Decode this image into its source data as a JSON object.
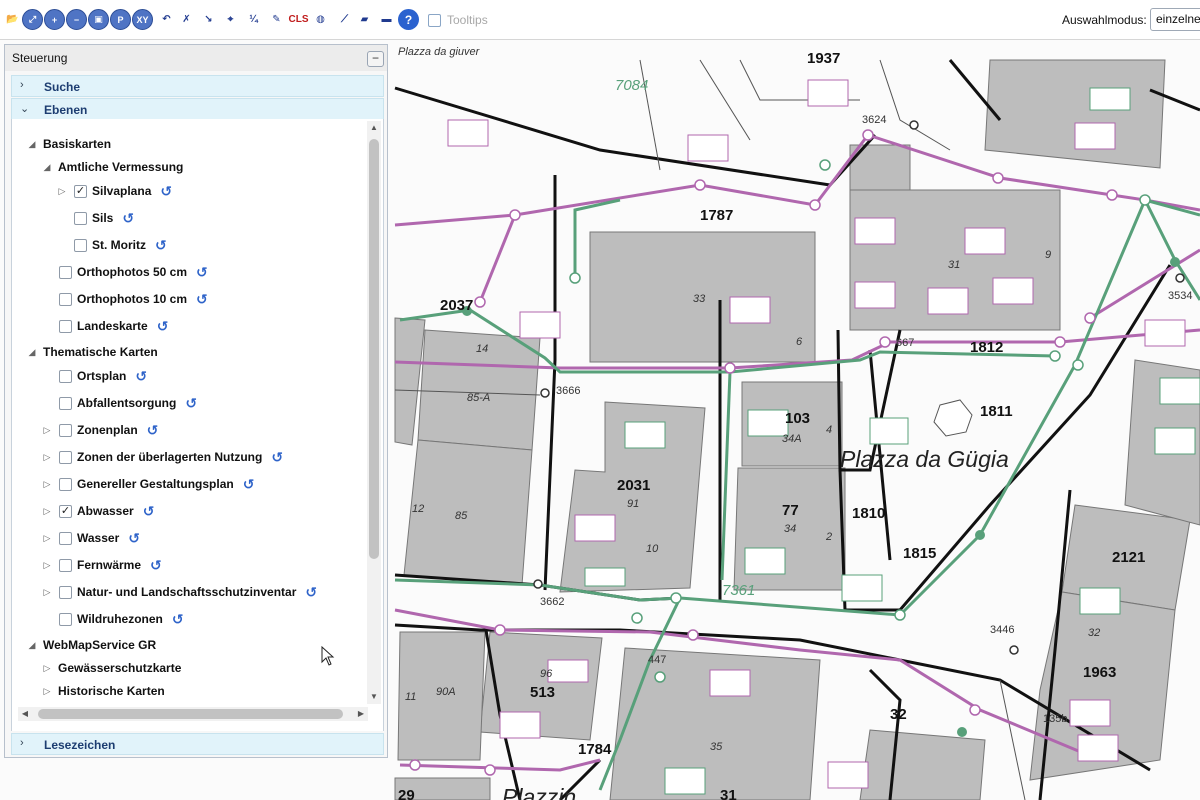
{
  "toolbar": {
    "buttons": [
      {
        "name": "open-folder-icon",
        "glyph": "📂",
        "style": ""
      },
      {
        "name": "zoom-full-extent-icon",
        "glyph": "⤢",
        "style": "round"
      },
      {
        "name": "zoom-in-icon",
        "glyph": "+",
        "style": "round"
      },
      {
        "name": "zoom-out-icon",
        "glyph": "−",
        "style": "round"
      },
      {
        "name": "zoom-box-icon",
        "glyph": "▣",
        "style": "round"
      },
      {
        "name": "pan-icon",
        "glyph": "P",
        "style": "round"
      },
      {
        "name": "coordinates-icon",
        "glyph": "XY",
        "style": "round"
      },
      {
        "name": "undo-icon",
        "glyph": "↶",
        "style": ""
      },
      {
        "name": "no-select-icon",
        "glyph": "✗",
        "style": ""
      },
      {
        "name": "measure-distance-icon",
        "glyph": "↘",
        "style": ""
      },
      {
        "name": "measure-area-icon",
        "glyph": "⌖",
        "style": ""
      },
      {
        "name": "scale-icon",
        "glyph": "¼",
        "style": ""
      },
      {
        "name": "draw-text-icon",
        "glyph": "✎",
        "style": ""
      },
      {
        "name": "clear-screen-icon",
        "glyph": "CLS",
        "style": "cls"
      },
      {
        "name": "globe-icon",
        "glyph": "◍",
        "style": ""
      },
      {
        "name": "eyedropper-icon",
        "glyph": "⟋",
        "style": ""
      },
      {
        "name": "highlight-icon",
        "glyph": "▰",
        "style": ""
      },
      {
        "name": "print-icon",
        "glyph": "▬",
        "style": ""
      },
      {
        "name": "help-icon",
        "glyph": "?",
        "style": "help"
      }
    ],
    "tooltips_label": "Tooltips",
    "mode_label": "Auswahlmodus:",
    "mode_value": "einzelne"
  },
  "panel": {
    "title": "Steuerung",
    "collapse": "−",
    "sections": {
      "suche": "Suche",
      "ebenen": "Ebenen",
      "lesezeichen": "Lesezeichen"
    },
    "tree": [
      {
        "label": "Basiskarten",
        "level": 0,
        "expander": "◢",
        "checkbox": false,
        "checked": false,
        "refresh": false
      },
      {
        "label": "Amtliche Vermessung",
        "level": 1,
        "expander": "◢",
        "checkbox": false,
        "checked": false,
        "refresh": false
      },
      {
        "label": "Silvaplana",
        "level": 2,
        "expander": "▷",
        "checkbox": true,
        "checked": true,
        "refresh": true
      },
      {
        "label": "Sils",
        "level": 2,
        "expander": "",
        "checkbox": true,
        "checked": false,
        "refresh": true
      },
      {
        "label": "St. Moritz",
        "level": 2,
        "expander": "",
        "checkbox": true,
        "checked": false,
        "refresh": true
      },
      {
        "label": "Orthophotos 50 cm",
        "level": 1,
        "expander": "",
        "checkbox": true,
        "checked": false,
        "refresh": true
      },
      {
        "label": "Orthophotos 10 cm",
        "level": 1,
        "expander": "",
        "checkbox": true,
        "checked": false,
        "refresh": true
      },
      {
        "label": "Landeskarte",
        "level": 1,
        "expander": "",
        "checkbox": true,
        "checked": false,
        "refresh": true
      },
      {
        "label": "Thematische Karten",
        "level": 0,
        "expander": "◢",
        "checkbox": false,
        "checked": false,
        "refresh": false
      },
      {
        "label": "Ortsplan",
        "level": 1,
        "expander": "",
        "checkbox": true,
        "checked": false,
        "refresh": true
      },
      {
        "label": "Abfallentsorgung",
        "level": 1,
        "expander": "",
        "checkbox": true,
        "checked": false,
        "refresh": true
      },
      {
        "label": "Zonenplan",
        "level": 1,
        "expander": "▷",
        "checkbox": true,
        "checked": false,
        "refresh": true
      },
      {
        "label": "Zonen der überlagerten Nutzung",
        "level": 1,
        "expander": "▷",
        "checkbox": true,
        "checked": false,
        "refresh": true
      },
      {
        "label": "Genereller Gestaltungsplan",
        "level": 1,
        "expander": "▷",
        "checkbox": true,
        "checked": false,
        "refresh": true
      },
      {
        "label": "Abwasser",
        "level": 1,
        "expander": "▷",
        "checkbox": true,
        "checked": true,
        "refresh": true
      },
      {
        "label": "Wasser",
        "level": 1,
        "expander": "▷",
        "checkbox": true,
        "checked": false,
        "refresh": true
      },
      {
        "label": "Fernwärme",
        "level": 1,
        "expander": "▷",
        "checkbox": true,
        "checked": false,
        "refresh": true
      },
      {
        "label": "Natur- und Landschaftsschutzinventar",
        "level": 1,
        "expander": "▷",
        "checkbox": true,
        "checked": false,
        "refresh": true
      },
      {
        "label": "Wildruhezonen",
        "level": 1,
        "expander": "",
        "checkbox": true,
        "checked": false,
        "refresh": true
      },
      {
        "label": "WebMapService GR",
        "level": 0,
        "expander": "◢",
        "checkbox": false,
        "checked": false,
        "refresh": false
      },
      {
        "label": "Gewässerschutzkarte",
        "level": 1,
        "expander": "▷",
        "checkbox": false,
        "checked": false,
        "refresh": false
      },
      {
        "label": "Historische Karten",
        "level": 1,
        "expander": "▷",
        "checkbox": false,
        "checked": false,
        "refresh": false
      }
    ]
  },
  "map": {
    "colors": {
      "building": "#bdbdbd",
      "water": "#58a07a",
      "sewer": "#b067ae",
      "road": "#111111"
    },
    "labels": {
      "street_top": "Plazza da giuver",
      "square": "Plazza da Gügia",
      "street_bottom": "Plazzin",
      "parcels": [
        "1937",
        "1787",
        "2037",
        "1812",
        "1811",
        "103",
        "2031",
        "77",
        "1810",
        "1815",
        "2121",
        "513",
        "1784",
        "1963",
        "32",
        "29",
        "31",
        "3534",
        "3624",
        "3662",
        "3446",
        "667",
        "3666",
        "135b",
        "447"
      ],
      "houses": [
        "33",
        "31",
        "14",
        "85-A",
        "85",
        "91",
        "10",
        "12",
        "34A",
        "34",
        "4",
        "6",
        "2",
        "32",
        "35",
        "11",
        "90A",
        "96",
        "9"
      ],
      "pipe_ids": [
        "7084",
        "7361"
      ]
    }
  }
}
